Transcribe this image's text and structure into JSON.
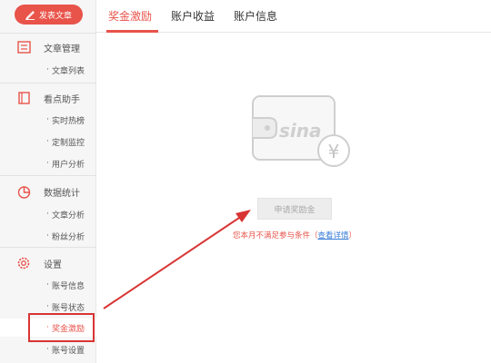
{
  "sidebar": {
    "post_button": "发表文章",
    "sections": [
      {
        "label": "文章管理",
        "items": [
          "文章列表"
        ]
      },
      {
        "label": "看点助手",
        "items": [
          "实时热榜",
          "定制监控",
          "用户分析"
        ]
      },
      {
        "label": "数据统计",
        "items": [
          "文章分析",
          "粉丝分析"
        ]
      },
      {
        "label": "设置",
        "items": [
          "账号信息",
          "账号状态",
          "奖金激励",
          "账号设置"
        ]
      }
    ]
  },
  "tabs": [
    {
      "label": "奖金激励",
      "active": true
    },
    {
      "label": "账户收益",
      "active": false
    },
    {
      "label": "账户信息",
      "active": false
    }
  ],
  "main": {
    "apply_button": "申请奖励金",
    "notice_prefix": "您本月不满足参与条件（",
    "notice_link": "查看详情",
    "notice_suffix": "）",
    "wallet_logo_text": "sina",
    "currency_symbol": "¥"
  },
  "colors": {
    "accent": "#e8534a",
    "link": "#3a7dd8",
    "annotation": "#d93434"
  }
}
